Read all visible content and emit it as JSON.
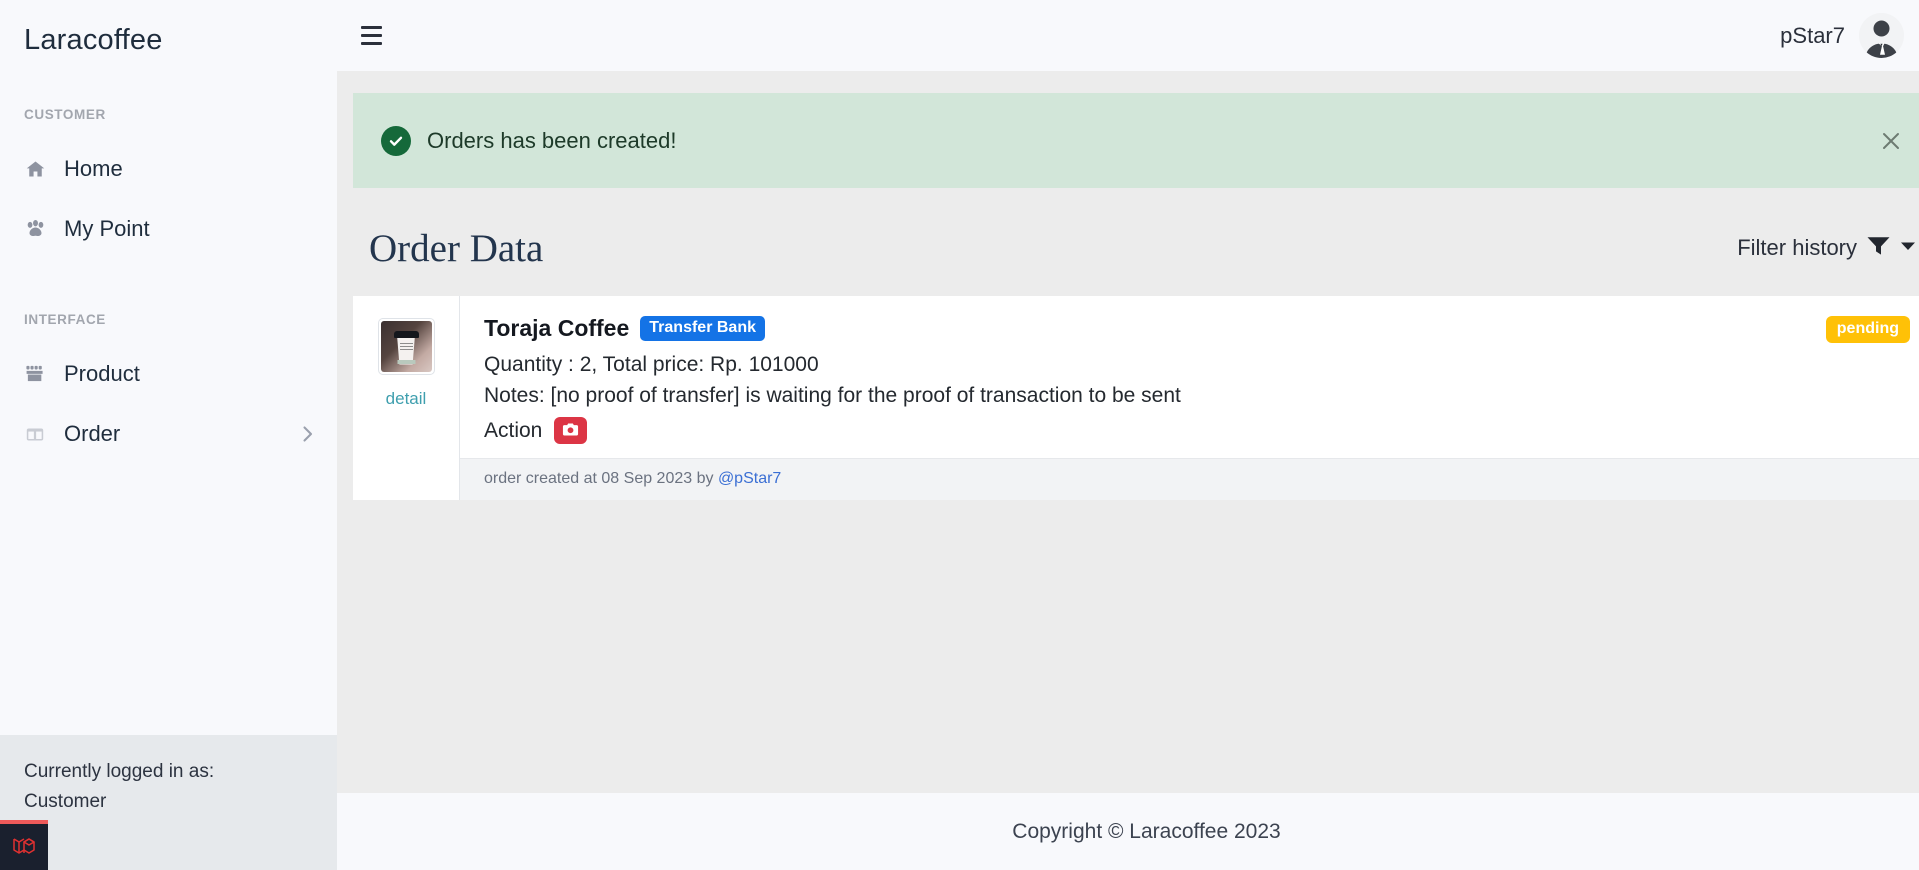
{
  "sidebar": {
    "brand": "Laracoffee",
    "sections": [
      {
        "heading": "CUSTOMER"
      },
      {
        "heading": "INTERFACE"
      }
    ],
    "items": [
      {
        "label": "Home",
        "icon": "home-icon"
      },
      {
        "label": "My Point",
        "icon": "paw-icon"
      },
      {
        "label": "Product",
        "icon": "store-icon"
      },
      {
        "label": "Order",
        "icon": "columns-icon",
        "chevron": "chevron-right-icon"
      }
    ],
    "footer": {
      "line1": "Currently logged in as:",
      "line2": "Customer"
    },
    "debugbar_icon": "laravel-logo-icon"
  },
  "topbar": {
    "menu_icon": "hamburger-icon",
    "user_name": "pStar7",
    "avatar_icon": "user-avatar-icon",
    "caret_icon": "caret-down-icon"
  },
  "alert": {
    "icon": "check-circle-icon",
    "message": "Orders has been created!",
    "close_icon": "close-icon",
    "background": "#d2e6d9",
    "icon_color": "#15693a"
  },
  "page": {
    "title": "Order Data",
    "filter": {
      "label": "Filter history",
      "icon": "filter-icon",
      "caret": "caret-down-icon"
    }
  },
  "orders": [
    {
      "thumb_alt": "coffee-cup-thumbnail",
      "detail_label": "detail",
      "product_name": "Toraja Coffee",
      "payment_method": "Transfer Bank",
      "status": "pending",
      "status_color": "#ffc107",
      "method_color": "#1473e6",
      "quantity_line": "Quantity : 2, Total price: Rp. 101000",
      "notes_line": "Notes: [no proof of transfer] is waiting for the proof of transaction to be sent",
      "action_label": "Action",
      "action_icon": "camera-icon",
      "action_color": "#dc3545",
      "footer_prefix": "order created at 08 Sep 2023 by ",
      "footer_user": "@pStar7"
    }
  ],
  "footer": {
    "copyright": "Copyright © Laracoffee 2023"
  }
}
